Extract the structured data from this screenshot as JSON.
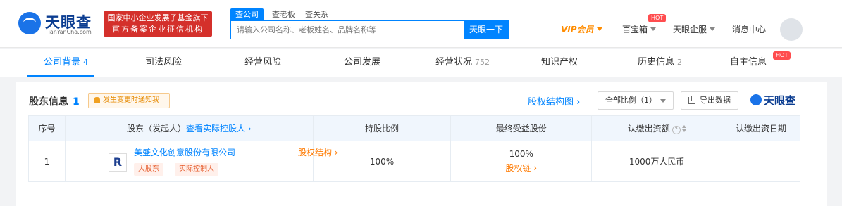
{
  "header": {
    "logo_text": "天眼查",
    "logo_sub": "TianYanCha.com",
    "gov_badge_line1": "国家中小企业发展子基金旗下",
    "gov_badge_line2": "官方备案企业征信机构",
    "search_tabs": [
      "查公司",
      "查老板",
      "查关系"
    ],
    "search_placeholder": "请输入公司名称、老板姓名、品牌名称等",
    "search_button": "天眼一下",
    "nav": {
      "vip": "VIP会员",
      "treasure": "百宝箱",
      "hot": "HOT",
      "enterprise": "天眼企服",
      "messages": "消息中心"
    }
  },
  "tabs": [
    {
      "label": "公司背景",
      "count": "4"
    },
    {
      "label": "司法风险",
      "count": ""
    },
    {
      "label": "经营风险",
      "count": ""
    },
    {
      "label": "公司发展",
      "count": ""
    },
    {
      "label": "经营状况",
      "count": "752"
    },
    {
      "label": "知识产权",
      "count": ""
    },
    {
      "label": "历史信息",
      "count": "2"
    },
    {
      "label": "自主信息",
      "count": ""
    }
  ],
  "tab_hot": "HOT",
  "section": {
    "title": "股东信息",
    "count": "1",
    "notice": "发生变更时通知我",
    "equity_link": "股权结构图",
    "ratio_select": "全部比例（1）",
    "export": "导出数据",
    "brand": "天眼查"
  },
  "table": {
    "headers": {
      "no": "序号",
      "shareholder": "股东（发起人）",
      "actual_link": "查看实际控股人",
      "ratio": "持股比例",
      "final": "最终受益股份",
      "capital": "认缴出资额",
      "date": "认缴出资日期"
    },
    "rows": [
      {
        "no": "1",
        "logo": "R",
        "name": "美盛文化创意股份有限公司",
        "equity": "股权结构",
        "tags": [
          "大股东",
          "实际控制人"
        ],
        "ratio": "100%",
        "final_pct": "100%",
        "final_link": "股权链",
        "capital": "1000万人民币",
        "date": "-"
      }
    ]
  }
}
